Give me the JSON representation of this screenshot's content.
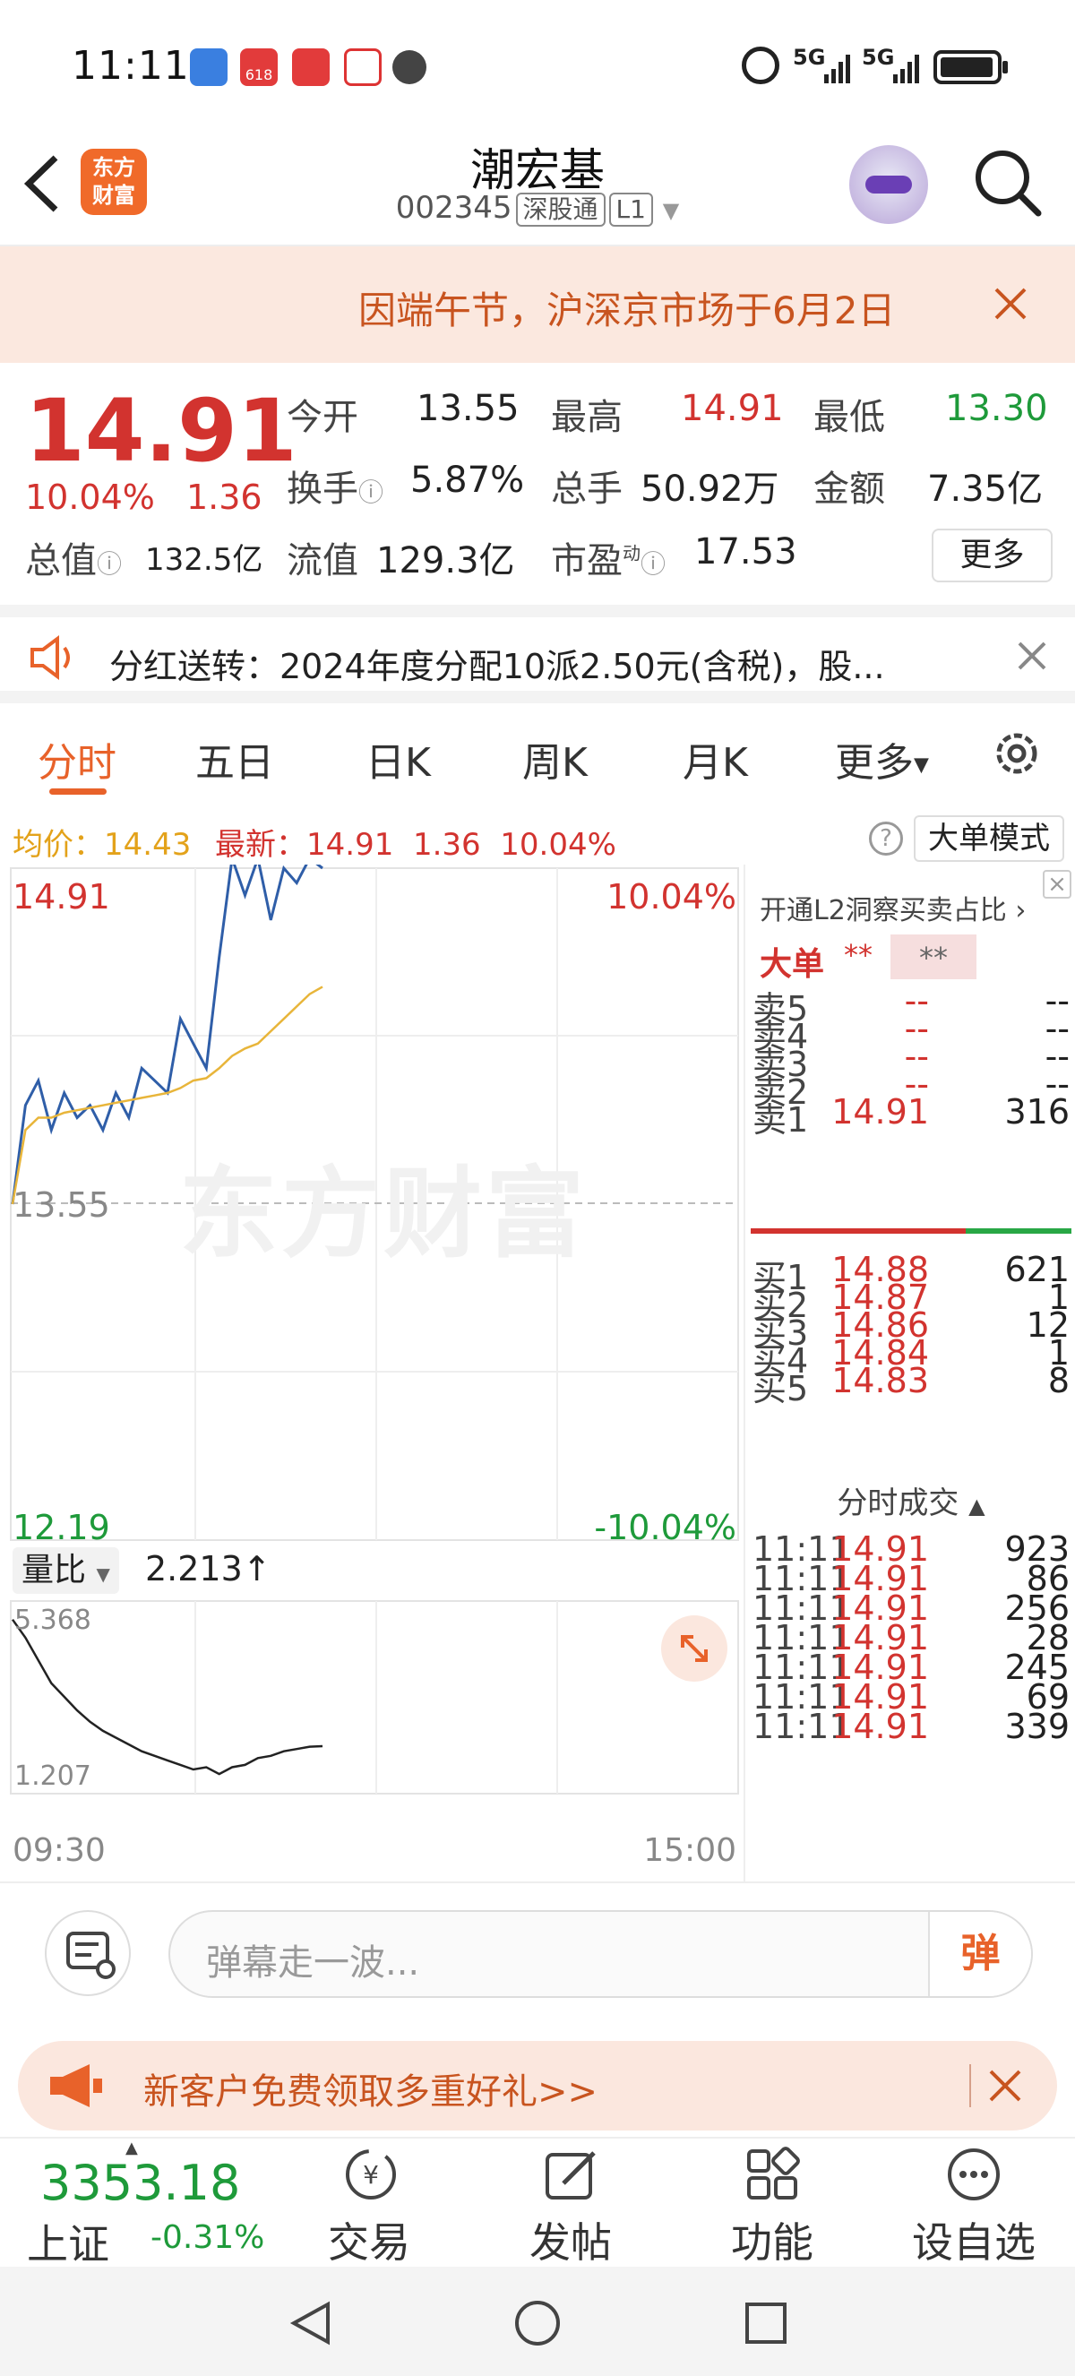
{
  "status_bar": {
    "time": "11:11",
    "network_1": "5G",
    "network_2": "5G",
    "app_icon_label": "618"
  },
  "header": {
    "app_logo_line1": "东方",
    "app_logo_line2": "财富",
    "stock_name": "潮宏基",
    "stock_code": "002345",
    "tag_connect": "深股通",
    "tag_level": "L1"
  },
  "notice": {
    "text": "因端午节，沪深京市场于6月2日"
  },
  "quote": {
    "price": "14.91",
    "change_pct": "10.04%",
    "change": "1.36",
    "open_label": "今开",
    "open": "13.55",
    "high_label": "最高",
    "high": "14.91",
    "low_label": "最低",
    "low": "13.30",
    "turnover_label": "换手",
    "turnover": "5.87%",
    "volume_label": "总手",
    "volume": "50.92万",
    "amount_label": "金额",
    "amount": "7.35亿",
    "total_cap_label": "总值",
    "total_cap": "132.5亿",
    "float_cap_label": "流值",
    "float_cap": "129.3亿",
    "pe_label": "市盈",
    "pe_sup": "动",
    "pe": "17.53",
    "more_button": "更多"
  },
  "dividend": {
    "text": "分红送转：2024年度分配10派2.50元(含税)，股..."
  },
  "tabs": [
    {
      "label": "分时",
      "active": true
    },
    {
      "label": "五日",
      "active": false
    },
    {
      "label": "日K",
      "active": false
    },
    {
      "label": "周K",
      "active": false
    },
    {
      "label": "月K",
      "active": false
    },
    {
      "label": "更多",
      "active": false
    }
  ],
  "avg_line": {
    "avg_label": "均价：",
    "avg_value": "14.43",
    "latest_label": "最新：",
    "latest_value": "14.91",
    "latest_change": "1.36",
    "latest_pct": "10.04%",
    "big_order_button": "大单模式"
  },
  "chart": {
    "y_top": "14.91",
    "y_mid": "13.55",
    "y_bottom": "12.19",
    "pct_top": "10.04%",
    "pct_bottom": "-10.04%",
    "watermark": "东方财富",
    "vol_ratio_label": "量比",
    "vol_ratio_value": "2.213↑",
    "vol_top": "5.368",
    "vol_bottom": "1.207",
    "time_start": "09:30",
    "time_end": "15:00",
    "colors": {
      "price": "#2f5ea8",
      "avg": "#e8b53a",
      "up": "#d2332f",
      "down": "#1e9a3a"
    }
  },
  "chart_data": {
    "type": "line",
    "series": [
      {
        "values": [
          13.55,
          13.95,
          14.05,
          13.85,
          14.0,
          13.9,
          13.95,
          13.85,
          14.0,
          13.9,
          14.1,
          14.05,
          14.0,
          14.3,
          14.2,
          14.1,
          14.55,
          14.95,
          14.8,
          14.95,
          14.7,
          14.91,
          14.85,
          14.95,
          14.91
        ]
      },
      {
        "values": [
          13.55,
          13.85,
          13.9,
          13.9,
          13.92,
          13.93,
          13.94,
          13.95,
          13.96,
          13.97,
          13.98,
          13.99,
          14.0,
          14.02,
          14.05,
          14.06,
          14.1,
          14.15,
          14.18,
          14.2,
          14.25,
          14.3,
          14.35,
          14.4,
          14.43
        ]
      }
    ],
    "ylim": [
      12.19,
      14.91
    ],
    "volume_ratio": {
      "values": [
        5.0,
        4.6,
        4.1,
        3.6,
        3.3,
        3.0,
        2.75,
        2.55,
        2.4,
        2.25,
        2.1,
        2.0,
        1.9,
        1.8,
        1.7,
        1.75,
        1.6,
        1.75,
        1.8,
        1.95,
        2.0,
        2.1,
        2.15,
        2.2,
        2.213
      ],
      "ylim": [
        1.207,
        5.368
      ]
    }
  },
  "depth": {
    "l2_link": "开通L2洞察买卖占比",
    "big_order_label": "大单",
    "big_order_v1": "**",
    "big_order_v2": "**",
    "sells": [
      {
        "label": "卖5",
        "price": "--",
        "vol": "--"
      },
      {
        "label": "卖4",
        "price": "--",
        "vol": "--"
      },
      {
        "label": "卖3",
        "price": "--",
        "vol": "--"
      },
      {
        "label": "卖2",
        "price": "--",
        "vol": "--"
      },
      {
        "label": "卖1",
        "price": "14.91",
        "vol": "316"
      }
    ],
    "buys": [
      {
        "label": "买1",
        "price": "14.88",
        "vol": "621"
      },
      {
        "label": "买2",
        "price": "14.87",
        "vol": "1"
      },
      {
        "label": "买3",
        "price": "14.86",
        "vol": "12"
      },
      {
        "label": "买4",
        "price": "14.84",
        "vol": "1"
      },
      {
        "label": "买5",
        "price": "14.83",
        "vol": "8"
      }
    ],
    "ticks_title": "分时成交",
    "ticks": [
      {
        "time": "11:11",
        "price": "14.91",
        "vol": "923"
      },
      {
        "time": "11:11",
        "price": "14.91",
        "vol": "86"
      },
      {
        "time": "11:11",
        "price": "14.91",
        "vol": "256"
      },
      {
        "time": "11:11",
        "price": "14.91",
        "vol": "28"
      },
      {
        "time": "11:11",
        "price": "14.91",
        "vol": "245"
      },
      {
        "time": "11:11",
        "price": "14.91",
        "vol": "69"
      },
      {
        "time": "11:11",
        "price": "14.91",
        "vol": "339"
      }
    ]
  },
  "comment_bar": {
    "placeholder": "弹幕走一波...",
    "danmu_button": "弹"
  },
  "promo": {
    "text": "新客户免费领取多重好礼>>"
  },
  "bottom_nav": {
    "index_value": "3353.18",
    "index_name": "上证",
    "index_change": "-0.31%",
    "items": [
      {
        "label": "交易",
        "icon": "yen-exchange-icon"
      },
      {
        "label": "发帖",
        "icon": "edit-icon"
      },
      {
        "label": "功能",
        "icon": "grid-icon"
      },
      {
        "label": "设自选",
        "icon": "more-dots-icon"
      }
    ]
  }
}
